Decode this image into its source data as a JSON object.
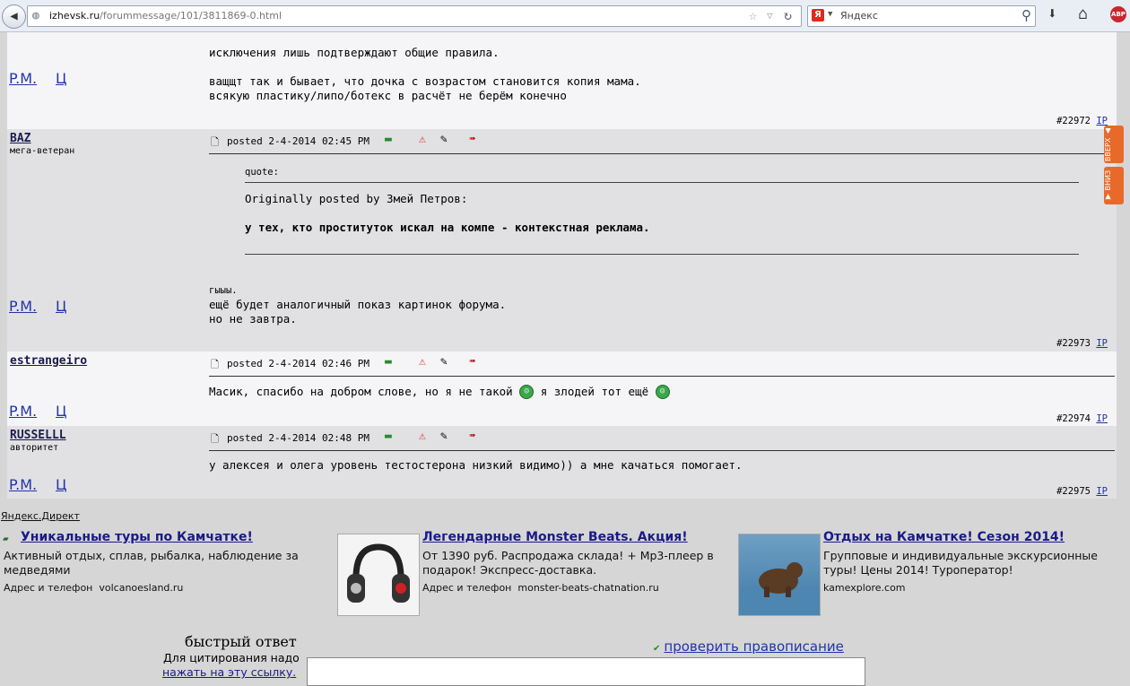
{
  "browser": {
    "url_domain": "izhevsk.ru",
    "url_path": "/forummessage/101/3811869-0.html",
    "search_placeholder": "Яндекс",
    "search_engine_letter": "Я",
    "addon_label": "ABP"
  },
  "posts": [
    {
      "lines": [
        "исключения лишь подтверждают общие правила.",
        "",
        "ващщт так и бывает, что дочка с возрастом становится копия мама.",
        "всякую пластику/липо/ботекс в расчёт не берём конечно"
      ],
      "pm": "P.M.",
      "c": "Ц",
      "number": "#22972",
      "ip": "IP"
    },
    {
      "user": "BAZ",
      "rank": "мега-ветеран",
      "posted": "posted 2-4-2014 02:45 PM",
      "quote_label": "quote:",
      "quote_author": "Originally posted by Змей Петров:",
      "quote_text": "у тех, кто проституток искал на компе - контекстная реклама.",
      "lines": [
        "гыыы.",
        "ещё будет аналогичный показ картинок форума.",
        "но не завтра."
      ],
      "pm": "P.M.",
      "c": "Ц",
      "number": "#22973",
      "ip": "IP"
    },
    {
      "user": "estrangeiro",
      "rank": "",
      "posted": "posted 2-4-2014 02:46 PM",
      "text_a": "Масик, спасибо на добром слове, но я не такой",
      "text_b": "я злодей тот ещё",
      "pm": "P.M.",
      "c": "Ц",
      "number": "#22974",
      "ip": "IP"
    },
    {
      "user": "RUSSELLL",
      "rank": "авторитет",
      "posted": "posted 2-4-2014 02:48 PM",
      "lines": [
        "у алексея и олега уровень тестостерона низкий видимо)) а мне качаться помогает."
      ],
      "pm": "P.M.",
      "c": "Ц",
      "number": "#22975",
      "ip": "IP"
    }
  ],
  "scroll": {
    "up": "ВВЕРХ",
    "down": "ВНИЗ"
  },
  "ads": {
    "header": "Яндекс.Директ",
    "items": [
      {
        "title": "Уникальные туры по Камчатке!",
        "text": "Активный отдых, сплав, рыбалка, наблюдение за медведями",
        "address_label": "Адрес и телефон",
        "domain": "volcanoesland.ru"
      },
      {
        "title": "Легендарные Monster Beats. Акция!",
        "text": "От 1390 руб. Распродажа склада! + Mp3-плеер в подарок! Экспресс-доставка.",
        "address_label": "Адрес и телефон",
        "domain": "monster-beats-chatnation.ru"
      },
      {
        "title": "Отдых на Камчатке! Сезон 2014!",
        "text": "Групповые и индивидуальные экскурсионные туры! Цены 2014! Туроператор!",
        "address_label": "",
        "domain": "kamexplore.com"
      }
    ]
  },
  "quick_reply": {
    "title": "быстрый ответ",
    "hint": "Для цитирования надо",
    "link": "нажать на эту ссылку.",
    "spellcheck": "проверить правописание"
  }
}
